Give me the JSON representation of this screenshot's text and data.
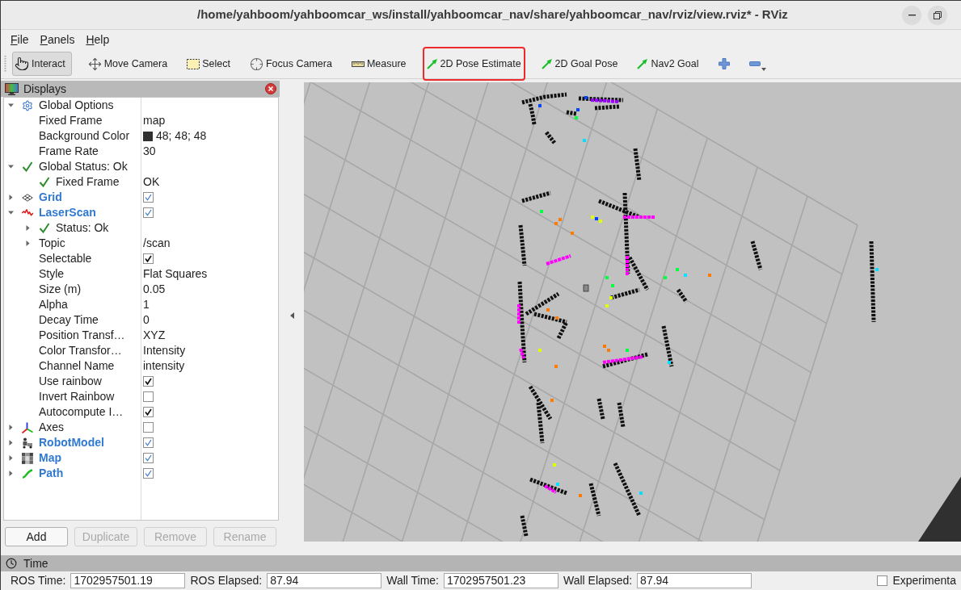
{
  "window": {
    "title": "/home/yahboom/yahboomcar_ws/install/yahboomcar_nav/share/yahboomcar_nav/rviz/view.rviz* - RViz"
  },
  "menu": [
    {
      "label": "File"
    },
    {
      "label": "Panels"
    },
    {
      "label": "Help"
    }
  ],
  "toolbar": [
    {
      "kind": "interact",
      "label": "Interact",
      "selected": true,
      "highlighted": false
    },
    {
      "kind": "move",
      "label": "Move Camera",
      "selected": false,
      "highlighted": false
    },
    {
      "kind": "select",
      "label": "Select",
      "selected": false,
      "highlighted": false
    },
    {
      "kind": "focus",
      "label": "Focus Camera",
      "selected": false,
      "highlighted": false
    },
    {
      "kind": "measure",
      "label": "Measure",
      "selected": false,
      "highlighted": false
    },
    {
      "kind": "pose",
      "label": "2D Pose Estimate",
      "selected": false,
      "highlighted": true
    },
    {
      "kind": "pose",
      "label": "2D Goal Pose",
      "selected": false,
      "highlighted": false
    },
    {
      "kind": "pose",
      "label": "Nav2 Goal",
      "selected": false,
      "highlighted": false
    },
    {
      "kind": "add",
      "selected": false,
      "highlighted": false
    },
    {
      "kind": "remove",
      "selected": false,
      "highlighted": false
    }
  ],
  "displays": {
    "title": "Displays",
    "tree": [
      {
        "kind": "options",
        "label": "Global Options",
        "expanded": true,
        "children": [
          {
            "label": "Fixed Frame",
            "value": "map"
          },
          {
            "label": "Background Color",
            "value": "48; 48; 48",
            "color": "#303030"
          },
          {
            "label": "Frame Rate",
            "value": "30"
          }
        ]
      },
      {
        "kind": "status",
        "label": "Global Status: Ok",
        "expanded": true,
        "children": [
          {
            "kind": "status",
            "label": "Fixed Frame",
            "value": "OK"
          }
        ]
      },
      {
        "kind": "grid",
        "label": "Grid",
        "expanded": false,
        "enabled": true
      },
      {
        "kind": "scan",
        "label": "LaserScan",
        "expanded": true,
        "enabled": true,
        "children": [
          {
            "kind": "status",
            "label": "Status: Ok",
            "expanded": false
          },
          {
            "label": "Topic",
            "expanded": false,
            "value": "/scan"
          },
          {
            "label": "Selectable",
            "checked": true
          },
          {
            "label": "Style",
            "value": "Flat Squares"
          },
          {
            "label": "Size (m)",
            "value": "0.05"
          },
          {
            "label": "Alpha",
            "value": "1"
          },
          {
            "label": "Decay Time",
            "value": "0"
          },
          {
            "label": "Position Transf…",
            "value": "XYZ"
          },
          {
            "label": "Color Transfor…",
            "value": "Intensity"
          },
          {
            "label": "Channel Name",
            "value": "intensity"
          },
          {
            "label": "Use rainbow",
            "checked": true
          },
          {
            "label": "Invert Rainbow",
            "checked": false
          },
          {
            "label": "Autocompute I…",
            "checked": true
          }
        ]
      },
      {
        "kind": "axes",
        "label": "Axes",
        "expanded": false,
        "enabled": false
      },
      {
        "kind": "robot",
        "label": "RobotModel",
        "expanded": false,
        "enabled": true
      },
      {
        "kind": "map",
        "label": "Map",
        "expanded": false,
        "enabled": true
      },
      {
        "kind": "path",
        "label": "Path",
        "expanded": false,
        "enabled": true
      }
    ],
    "buttons": [
      {
        "label": "Add",
        "disabled": false
      },
      {
        "label": "Duplicate",
        "disabled": true
      },
      {
        "label": "Remove",
        "disabled": true
      },
      {
        "label": "Rename",
        "disabled": true
      }
    ]
  },
  "time_panel": {
    "title": "Time",
    "fields": [
      {
        "label": "ROS Time:",
        "value": "1702957501.19"
      },
      {
        "label": "ROS Elapsed:",
        "value": "87.94"
      },
      {
        "label": "Wall Time:",
        "value": "1702957501.23"
      },
      {
        "label": "Wall Elapsed:",
        "value": "87.94"
      }
    ],
    "experimental": {
      "label": "Experimenta",
      "checked": false
    }
  }
}
